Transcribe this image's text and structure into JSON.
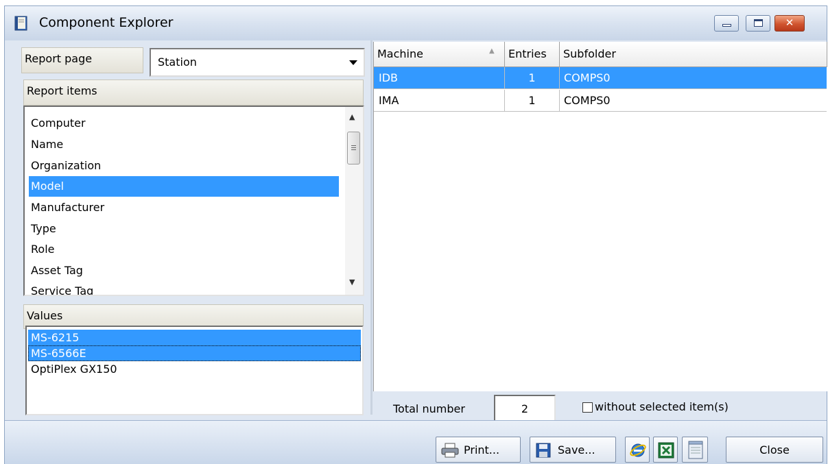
{
  "window": {
    "title": "Component Explorer"
  },
  "left": {
    "report_page_label": "Report page",
    "report_page_value": "Station",
    "report_items_label": "Report items",
    "report_items": [
      "Computer",
      "Name",
      "Organization",
      "Model",
      "Manufacturer",
      "Type",
      "Role",
      "Asset Tag",
      "Service Tag"
    ],
    "selected_item": "Model",
    "values_label": "Values",
    "values": [
      "MS-6215",
      "MS-6566E",
      "OptiPlex GX150"
    ]
  },
  "grid": {
    "columns": [
      "Machine",
      "Entries",
      "Subfolder"
    ],
    "rows": [
      {
        "machine": "IDB",
        "entries": "1",
        "subfolder": "COMPS0"
      },
      {
        "machine": "IMA",
        "entries": "1",
        "subfolder": "COMPS0"
      }
    ]
  },
  "footer": {
    "total_label": "Total number",
    "total_value": "2",
    "checkbox_label": "without selected item(s)",
    "print_label": "Print...",
    "save_label": "Save...",
    "close_label": "Close"
  },
  "colors": {
    "selection": "#3399ff",
    "close_button": "#d0542f"
  },
  "icons": [
    "book-icon",
    "printer-icon",
    "floppy-disk-icon",
    "internet-explorer-icon",
    "excel-icon",
    "notepad-icon"
  ]
}
